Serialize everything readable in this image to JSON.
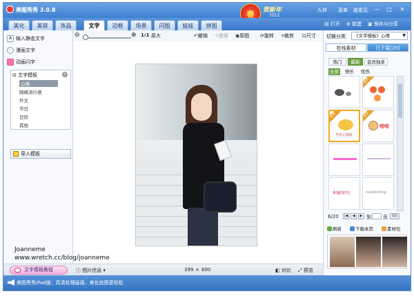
{
  "app": {
    "title": "美图秀秀 3.0.8"
  },
  "banner": {
    "badge": "春",
    "greeting": "贺新年",
    "year": "2012"
  },
  "titlebar": {
    "user": "九祥",
    "menu": "菜单",
    "feedback": "提意见"
  },
  "main_tabs": [
    "美化",
    "美容",
    "饰品",
    "文字",
    "边框",
    "场景",
    "闪图",
    "娃娃",
    "拼图"
  ],
  "tab_actions": {
    "open": "打开",
    "new": "新建",
    "save": "保存与分享"
  },
  "toolbar": {
    "ratio": "1:1",
    "original": "原大",
    "undo": "撤销",
    "redo": "重做",
    "original_image": "原图",
    "rotate": "旋转",
    "crop": "裁剪",
    "size": "尺寸"
  },
  "left_panel": {
    "static_text": "输入静态文字",
    "comic_text": "漫画文字",
    "animated_text": "动画闪字",
    "template_header": "文字模板",
    "template_items": [
      "心情",
      "网络流行语",
      "外文",
      "节日",
      "日历",
      "其他"
    ],
    "import_button": "导入模板"
  },
  "watermark": {
    "line1": "Joanneme",
    "line2": "www.wretch.cc/blog/joanneme"
  },
  "canvas_bar": {
    "tutorial": "文字模板教程",
    "image_info": "图片信息",
    "width": "399",
    "times": "×",
    "height": "600",
    "compare": "对比",
    "preview": "预览"
  },
  "right_panel": {
    "category_label": "切换分类",
    "category_value": "《文字模板》心情",
    "tabs": [
      "在线素材",
      "已下载[20]"
    ],
    "sub_tabs": [
      "热门",
      "最新",
      "会员独享"
    ],
    "filters": [
      "全部",
      "快乐",
      "忧伤"
    ],
    "thumb_badge": "会员",
    "thumb_texts": [
      "",
      "",
      "今天心情好",
      "哈哈",
      "",
      "",
      "幸福的时光",
      "handwriting"
    ],
    "pager": {
      "current": "6/20",
      "goto_label": "到",
      "page_unit": "页",
      "go": "GO"
    },
    "actions": [
      "刷新",
      "下载本页",
      "素材包"
    ]
  },
  "statusbar": {
    "text": "美图秀秀iPad版：高清处理画面，美化拍图更轻松"
  },
  "colors": {
    "accent": "#3d7fd1",
    "selected": "#6da246",
    "badge": "#e8a02a"
  },
  "icons": [
    "app-logo-icon",
    "undo-icon",
    "redo-icon",
    "rotate-icon",
    "crop-icon",
    "resize-icon",
    "zoom-out-icon",
    "zoom-in-icon",
    "speaker-icon",
    "refresh-icon",
    "download-icon",
    "package-icon"
  ]
}
